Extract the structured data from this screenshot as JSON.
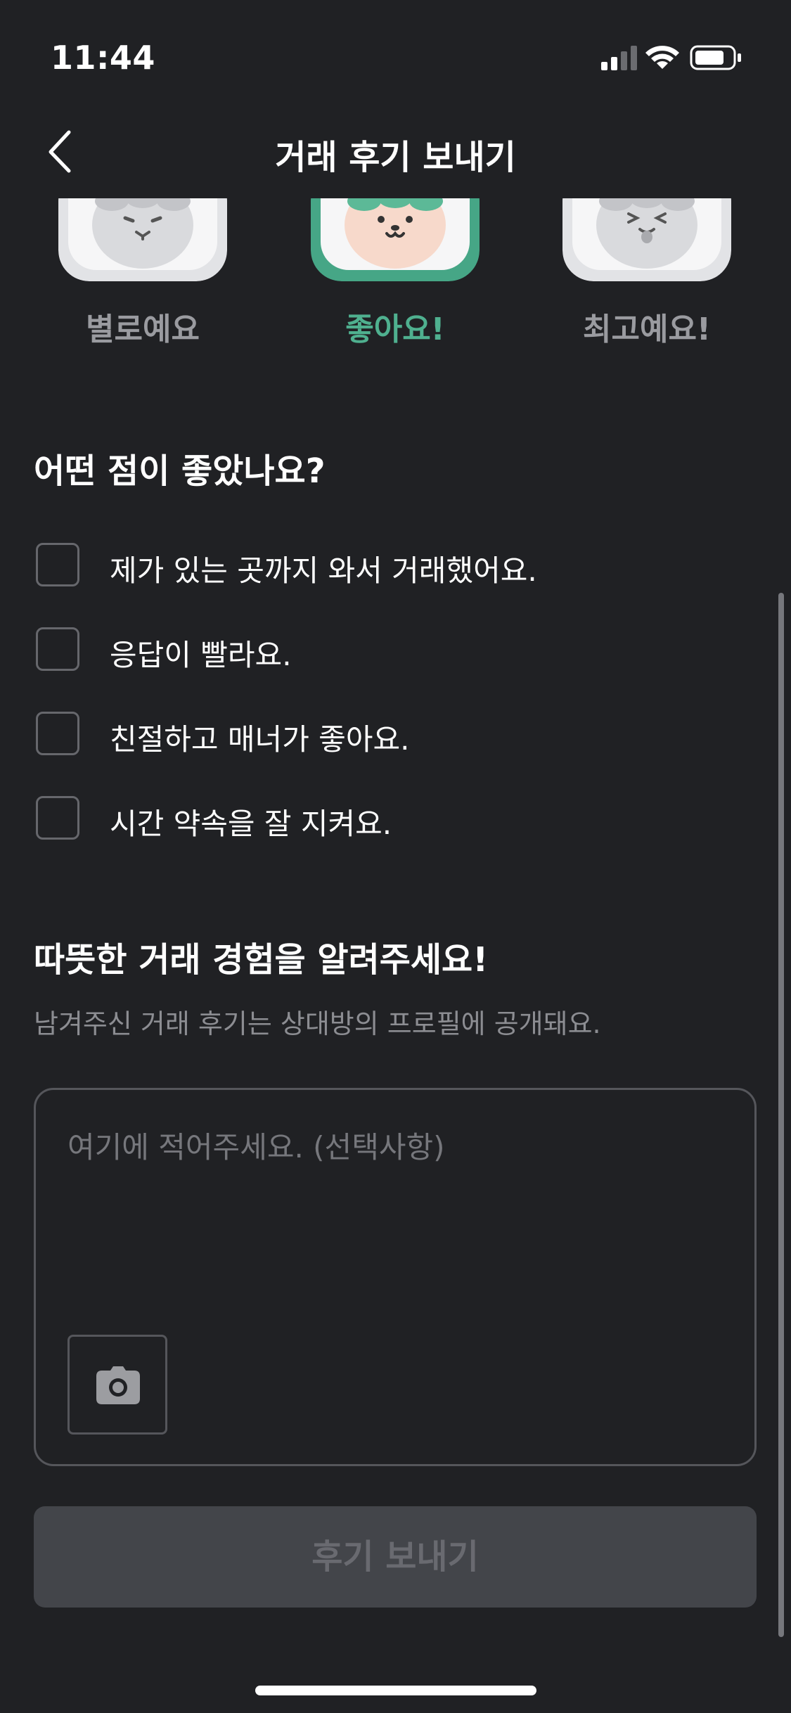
{
  "status_bar": {
    "time": "11:44",
    "icons": [
      "cellular-signal-icon",
      "wifi-icon",
      "battery-icon"
    ]
  },
  "header": {
    "title": "거래 후기 보내기",
    "back_icon": "chevron-left-icon"
  },
  "rating": {
    "options": [
      {
        "label": "별로예요",
        "selected": false
      },
      {
        "label": "좋아요!",
        "selected": true
      },
      {
        "label": "최고예요!",
        "selected": false
      }
    ]
  },
  "good_points": {
    "title": "어떤 점이 좋았나요?",
    "items": [
      {
        "label": "제가 있는 곳까지 와서 거래했어요.",
        "checked": false
      },
      {
        "label": "응답이 빨라요.",
        "checked": false
      },
      {
        "label": "친절하고 매너가 좋아요.",
        "checked": false
      },
      {
        "label": "시간 약속을 잘 지켜요.",
        "checked": false
      }
    ]
  },
  "experience": {
    "title": "따뜻한 거래 경험을 알려주세요!",
    "subtitle": "남겨주신 거래 후기는 상대방의 프로필에 공개돼요.",
    "placeholder": "여기에 적어주세요. (선택사항)",
    "photo_icon": "camera-icon"
  },
  "submit": {
    "label": "후기 보내기"
  },
  "colors": {
    "background": "#202124",
    "accent": "#4fb08f",
    "muted_text": "#8c8d92",
    "disabled_button": "#43454a"
  }
}
